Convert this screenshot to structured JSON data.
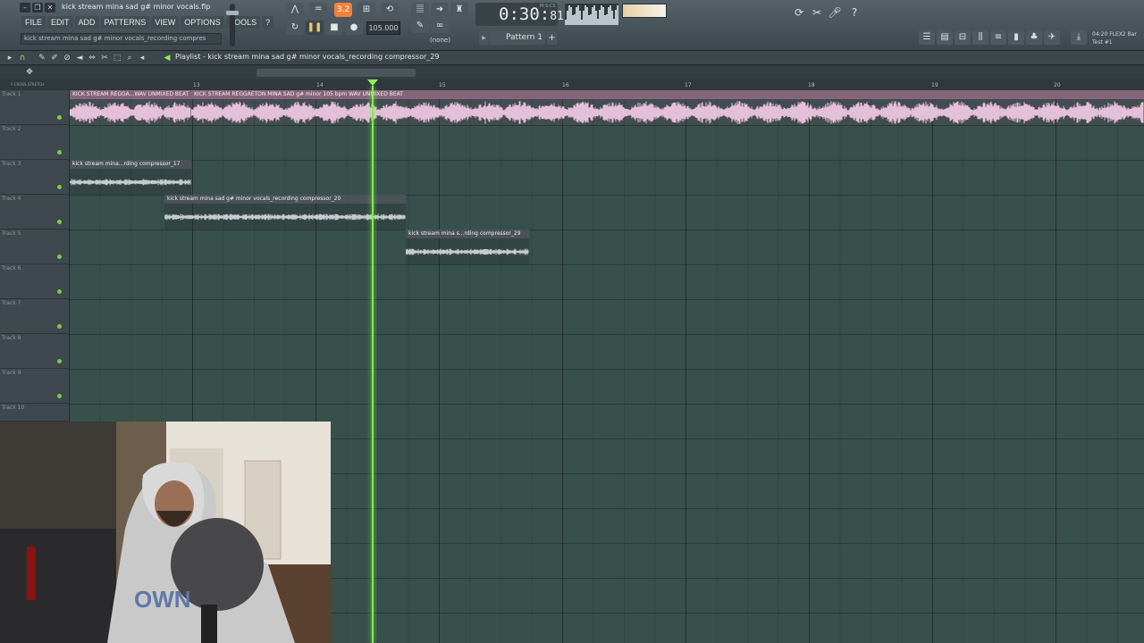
{
  "window": {
    "file_title": "kick stream mina sad g# minor vocals.flp",
    "hint": "kick stream mina sad g# minor vocals_recording compres"
  },
  "menu": [
    "FILE",
    "EDIT",
    "ADD",
    "PATTERNS",
    "VIEW",
    "OPTIONS",
    "TOOLS",
    "?"
  ],
  "transport": {
    "pattern_song_toggle": "3.2",
    "tempo": "105.000",
    "time_main": "0:30",
    "time_sub": "81",
    "time_unit": "M:S:CS",
    "pattern": "Pattern 1",
    "snap": "(none)"
  },
  "plugin_info": {
    "line1": "04:20  FLEX2 Bar",
    "line2": "Test #1"
  },
  "playlist": {
    "title": "Playlist - kick stream mina sad g# minor vocals_recording compressor_29",
    "ruler_left_labels": "F-CROSS   STRETCH",
    "bars": [
      "13",
      "14",
      "15",
      "16",
      "17",
      "18",
      "19",
      "20"
    ],
    "tracks": [
      "Track 1",
      "Track 2",
      "Track 3",
      "Track 4",
      "Track 5",
      "Track 6",
      "Track 7",
      "Track 8",
      "Track 9",
      "Track 10"
    ],
    "clips": [
      {
        "label": "KICK STREAM REGGA...WAV UNMIXED BEAT"
      },
      {
        "label": "KICK STREAM REGGAETON MINA SAD g# minor 105 bpm WAV UNMIXED BEAT"
      },
      {
        "label": "kick stream mina...rding compressor_17"
      },
      {
        "label": "kick stream mina sad g# minor vocals_recording compressor_20"
      },
      {
        "label": "kick stream mina s...rding compressor_29"
      }
    ]
  },
  "colors": {
    "grid": "#38504b",
    "playhead": "#7df04a",
    "accent": "#f2823a",
    "audio_clip_title": "#84667c"
  }
}
